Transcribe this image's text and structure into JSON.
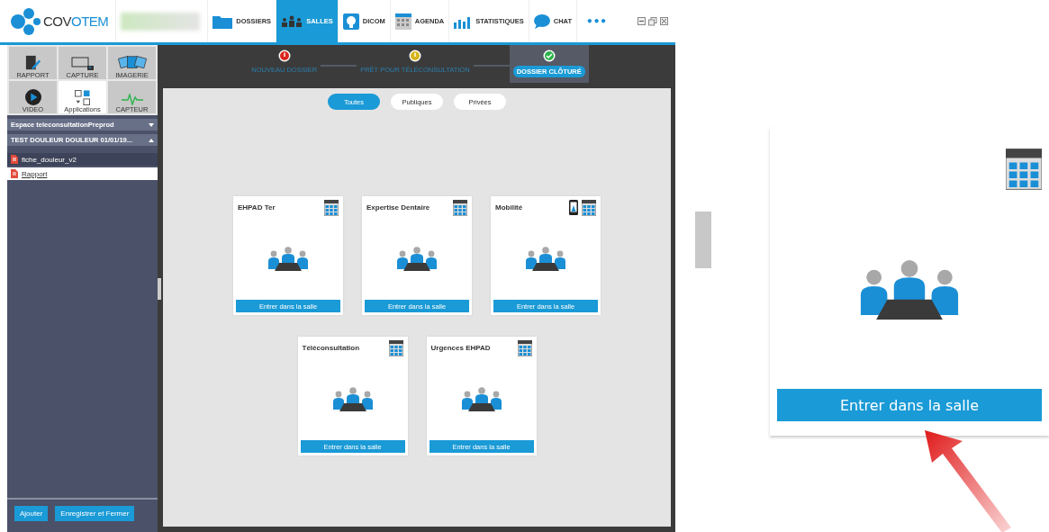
{
  "header": {
    "logo": {
      "main": "COV",
      "accent": "OTEM"
    },
    "nav": [
      {
        "label": "DOSSIERS",
        "selected": false
      },
      {
        "label": "SALLES",
        "selected": true
      },
      {
        "label": "DICOM",
        "selected": false
      },
      {
        "label": "AGENDA",
        "selected": false
      },
      {
        "label": "STATISTIQUES",
        "selected": false
      },
      {
        "label": "CHAT",
        "selected": false
      }
    ],
    "more": "•••"
  },
  "sidebar": {
    "tools": [
      {
        "label": "RAPPORT",
        "selected": false
      },
      {
        "label": "CAPTURE",
        "selected": false
      },
      {
        "label": "IMAGERIE",
        "selected": false
      },
      {
        "label": "VIDEO",
        "selected": false
      },
      {
        "label": "Applications",
        "selected": true
      },
      {
        "label": "CAPTEUR",
        "selected": false
      }
    ],
    "sections": [
      {
        "title": "Espace teleconsultationPreprod",
        "expanded": false
      },
      {
        "title": "TEST DOULEUR DOULEUR 01/01/19...",
        "expanded": true
      }
    ],
    "files": [
      {
        "name": "fiche_douleur_v2",
        "selected": false
      },
      {
        "name": "Rapport",
        "selected": true
      }
    ],
    "buttons": [
      "Ajouter",
      "Enregistrer et Fermer"
    ]
  },
  "stepper": [
    {
      "label": "NOUVEAU DOSSIER",
      "kind": "error",
      "selected": false
    },
    {
      "label": "PRÊT POUR TÉLÉCONSULTATION",
      "kind": "warning",
      "selected": false
    },
    {
      "label": "DOSSIER CLÔTURÉ",
      "kind": "done",
      "selected": true
    }
  ],
  "filters": [
    {
      "label": "Toutes",
      "selected": true
    },
    {
      "label": "Publiques",
      "selected": false
    },
    {
      "label": "Privées",
      "selected": false
    }
  ],
  "rooms": [
    [
      {
        "name": "EHPAD Ter",
        "mobile": false,
        "button": "Entrer dans la salle"
      },
      {
        "name": "Expertise Dentaire",
        "mobile": false,
        "button": "Entrer dans la salle"
      },
      {
        "name": "Mobilité",
        "mobile": true,
        "button": "Entrer dans la salle"
      }
    ],
    [
      {
        "name": "Téléconsultation",
        "mobile": false,
        "button": "Entrer dans la salle"
      },
      {
        "name": "Urgences EHPAD",
        "mobile": false,
        "button": "Entrer dans la salle"
      }
    ]
  ],
  "detail": {
    "button": "Entrer dans la salle"
  }
}
